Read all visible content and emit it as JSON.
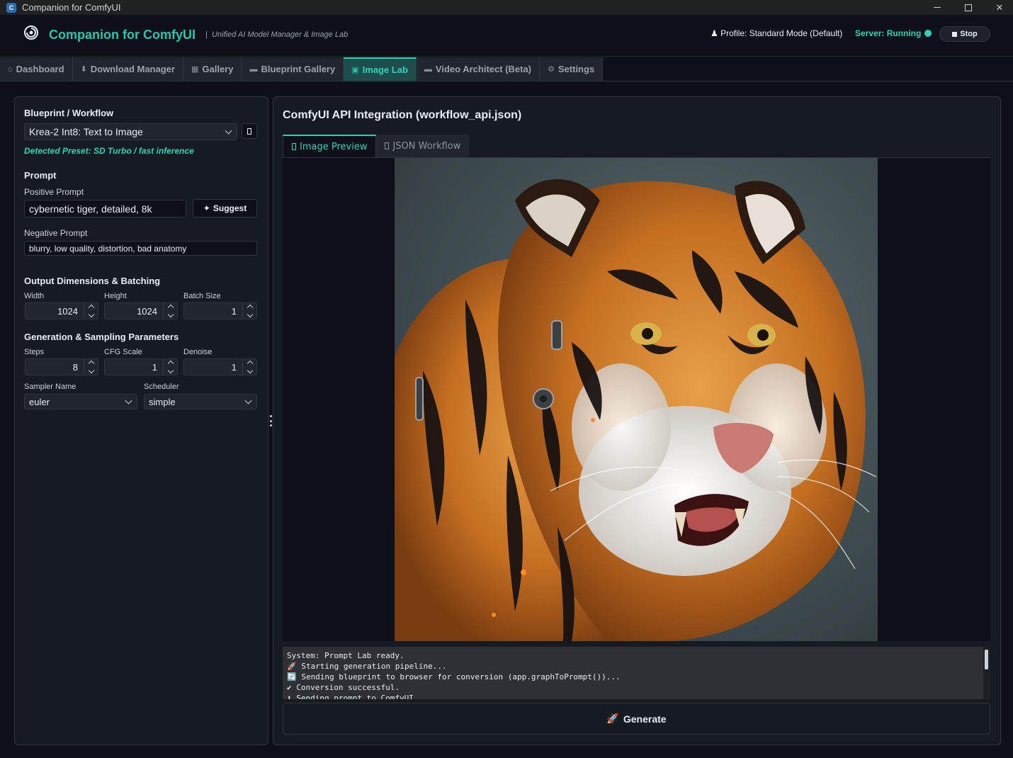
{
  "window": {
    "title": "Companion for ComfyUI"
  },
  "header": {
    "title": "Companion for ComfyUI",
    "subtitle": "Unified AI Model Manager & Image Lab",
    "profile": "Profile: Standard Mode (Default)",
    "server_status": "Server: Running",
    "stop_label": "Stop",
    "accent": "#2bd4b8"
  },
  "tabs": [
    {
      "label": "Dashboard",
      "icon": "home-icon"
    },
    {
      "label": "Download Manager",
      "icon": "download-icon"
    },
    {
      "label": "Gallery",
      "icon": "gallery-icon"
    },
    {
      "label": "Blueprint Gallery",
      "icon": "blueprint-icon"
    },
    {
      "label": "Image Lab",
      "icon": "image-lab-icon",
      "active": true
    },
    {
      "label": "Video Architect (Beta)",
      "icon": "video-icon"
    },
    {
      "label": "Settings",
      "icon": "gear-icon"
    }
  ],
  "left": {
    "blueprint_title": "Blueprint / Workflow",
    "workflow_selected": "Krea-2 Int8: Text to Image",
    "detected_preset": "Detected Preset: SD Turbo / fast inference",
    "prompt_title": "Prompt",
    "positive_label": "Positive Prompt",
    "positive_value": "cybernetic tiger, detailed, 8k",
    "suggest_label": "Suggest",
    "negative_label": "Negative Prompt",
    "negative_value": "blurry, low quality, distortion, bad anatomy",
    "output_title": "Output Dimensions & Batching",
    "width_label": "Width",
    "width_value": "1024",
    "height_label": "Height",
    "height_value": "1024",
    "batch_label": "Batch Size",
    "batch_value": "1",
    "gen_title": "Generation & Sampling Parameters",
    "steps_label": "Steps",
    "steps_value": "8",
    "cfg_label": "CFG Scale",
    "cfg_value": "1",
    "denoise_label": "Denoise",
    "denoise_value": "1",
    "sampler_label": "Sampler Name",
    "sampler_value": "euler",
    "scheduler_label": "Scheduler",
    "scheduler_value": "simple"
  },
  "right": {
    "title": "ComfyUI API Integration (workflow_api.json)",
    "subtabs": [
      {
        "label": "Image Preview",
        "active": true
      },
      {
        "label": "JSON Workflow"
      }
    ],
    "log": [
      "System: Prompt Lab ready.",
      "🚀 Starting generation pipeline...",
      "🔄 Sending blueprint to browser for conversion (app.graphToPrompt())...",
      "✔ Conversion successful.",
      "⬆ Sending prompt to ComfyUI..."
    ],
    "generate_label": "Generate"
  }
}
